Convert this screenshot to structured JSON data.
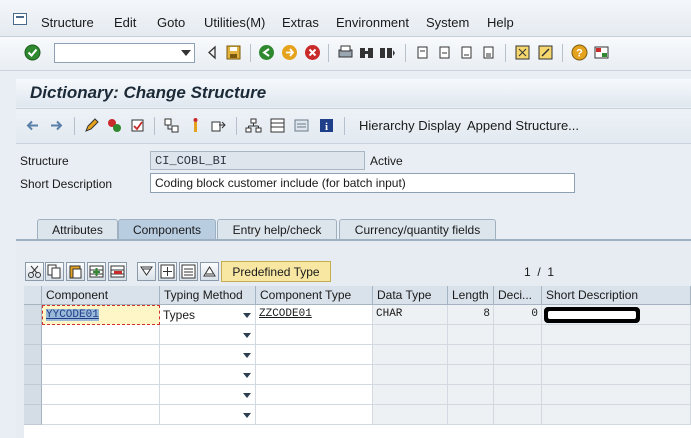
{
  "menubar": {
    "items": [
      "Structure",
      "Edit",
      "Goto",
      "Utilities(M)",
      "Extras",
      "Environment",
      "System",
      "Help"
    ]
  },
  "title": "Dictionary: Change Structure",
  "app_toolbar": {
    "hierarchy_label": "Hierarchy Display",
    "append_label": "Append Structure..."
  },
  "header": {
    "structure_label": "Structure",
    "structure_value": "CI_COBL_BI",
    "status": "Active",
    "short_desc_label": "Short Description",
    "short_desc_value": "Coding block customer include (for batch input)"
  },
  "tabs": [
    {
      "label": "Attributes",
      "active": false
    },
    {
      "label": "Components",
      "active": true
    },
    {
      "label": "Entry help/check",
      "active": false
    },
    {
      "label": "Currency/quantity fields",
      "active": false
    }
  ],
  "table_toolbar": {
    "predefined_type_label": "Predefined Type",
    "pager": "1  /  1"
  },
  "table": {
    "columns": [
      "Component",
      "Typing Method",
      "Component Type",
      "Data Type",
      "Length",
      "Deci...",
      "Short Description"
    ],
    "rows": [
      {
        "component": "YYCODE01",
        "typing_method": "Types",
        "component_type": "ZZCODE01",
        "data_type": "CHAR",
        "length": "8",
        "decimals": "0",
        "short_description": ""
      },
      {
        "component": "",
        "typing_method": "",
        "component_type": "",
        "data_type": "",
        "length": "",
        "decimals": "",
        "short_description": ""
      },
      {
        "component": "",
        "typing_method": "",
        "component_type": "",
        "data_type": "",
        "length": "",
        "decimals": "",
        "short_description": ""
      },
      {
        "component": "",
        "typing_method": "",
        "component_type": "",
        "data_type": "",
        "length": "",
        "decimals": "",
        "short_description": ""
      },
      {
        "component": "",
        "typing_method": "",
        "component_type": "",
        "data_type": "",
        "length": "",
        "decimals": "",
        "short_description": ""
      },
      {
        "component": "",
        "typing_method": "",
        "component_type": "",
        "data_type": "",
        "length": "",
        "decimals": "",
        "short_description": ""
      }
    ]
  }
}
